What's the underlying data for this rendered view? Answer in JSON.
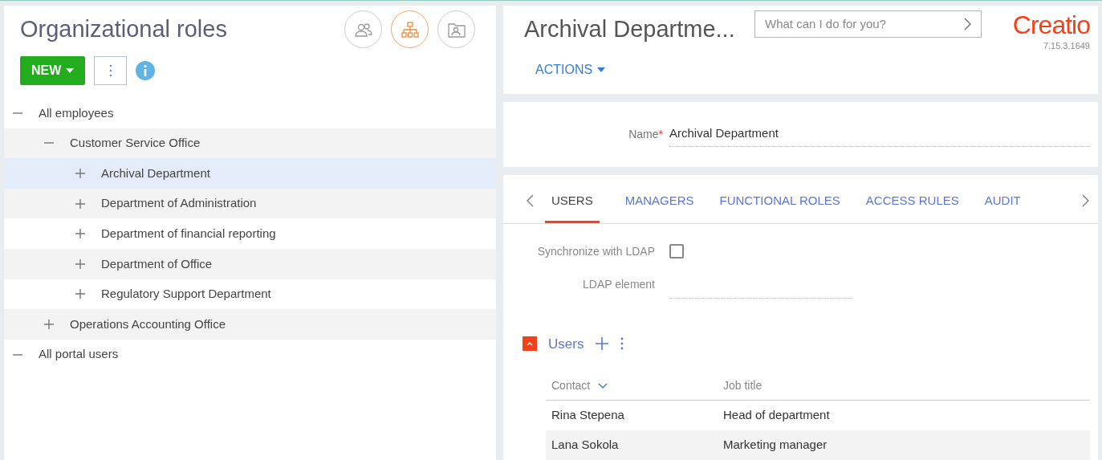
{
  "left": {
    "title": "Organizational roles",
    "view_buttons": [
      {
        "kind": "users",
        "selected": false
      },
      {
        "kind": "structure",
        "selected": true
      },
      {
        "kind": "folder",
        "selected": false
      }
    ],
    "new_button": "NEW"
  },
  "tree": [
    {
      "label": "All employees",
      "expanded": true,
      "selected": false,
      "children": [
        {
          "label": "Customer Service Office",
          "expanded": true,
          "selected": false,
          "children": [
            {
              "label": "Archival Department",
              "expanded": false,
              "selected": true
            },
            {
              "label": "Department of Administration",
              "expanded": false,
              "selected": false
            },
            {
              "label": "Department of financial reporting",
              "expanded": false,
              "selected": false
            },
            {
              "label": "Department of Office",
              "expanded": false,
              "selected": false
            },
            {
              "label": "Regulatory Support Department",
              "expanded": false,
              "selected": false
            }
          ]
        },
        {
          "label": "Operations Accounting Office",
          "expanded": false,
          "selected": false
        }
      ]
    },
    {
      "label": "All portal users",
      "expanded": true,
      "selected": false
    }
  ],
  "header": {
    "title": "Archival Departme...",
    "search": {
      "placeholder": "What can I do for you?"
    },
    "logo": "Creatio",
    "version": "7.15.3.1649",
    "actions": "ACTIONS"
  },
  "name_field": {
    "label": "Name",
    "required_mark": "*",
    "value": "Archival Department"
  },
  "tabs": [
    {
      "label": "USERS",
      "selected": true
    },
    {
      "label": "MANAGERS",
      "selected": false
    },
    {
      "label": "FUNCTIONAL ROLES",
      "selected": false
    },
    {
      "label": "ACCESS RULES",
      "selected": false
    },
    {
      "label": "AUDIT",
      "selected": false
    }
  ],
  "ldap": {
    "sync_label": "Synchronize with LDAP",
    "checked": false,
    "element_label": "LDAP element"
  },
  "users": {
    "title": "Users",
    "expanded": true,
    "columns": [
      "Contact",
      "Job title"
    ],
    "rows": [
      {
        "contact": "Rina Stepena",
        "job_title": "Head of department"
      },
      {
        "contact": "Lana Sokola",
        "job_title": "Marketing manager"
      }
    ]
  }
}
